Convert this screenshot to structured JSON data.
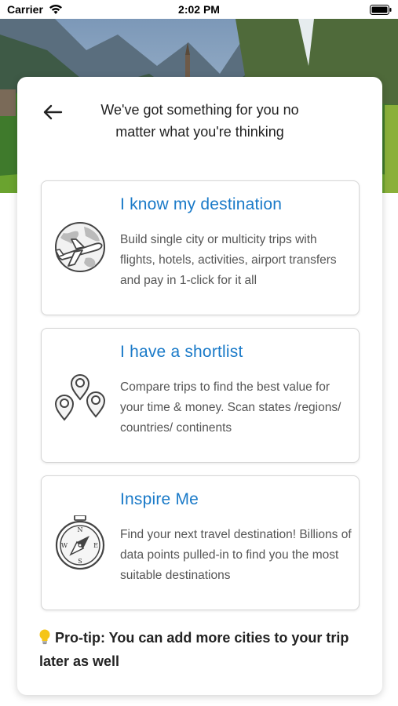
{
  "status_bar": {
    "carrier": "Carrier",
    "time": "2:02 PM"
  },
  "header": {
    "title": "We've got something for you no matter what you're thinking"
  },
  "options": [
    {
      "title": "I know my destination",
      "description": "Build single city or multicity trips with flights, hotels, activities, airport transfers and pay in 1-click for it all",
      "icon": "globe-plane-icon"
    },
    {
      "title": "I have a shortlist",
      "description": "Compare trips to find the best value for your time & money. Scan states /regions/ countries/ continents",
      "icon": "map-pins-icon"
    },
    {
      "title": "Inspire Me",
      "description": "Find your next travel destination! Billions of data points pulled-in to find you the most suitable destinations",
      "icon": "compass-icon"
    }
  ],
  "compass_labels": {
    "n": "N",
    "e": "E",
    "s": "S",
    "w": "W"
  },
  "protip": {
    "text": "Pro-tip: You can add more cities to your trip later as well",
    "icon": "lightbulb-icon"
  },
  "colors": {
    "accent": "#1a7ac8",
    "bulb": "#f5c518"
  }
}
